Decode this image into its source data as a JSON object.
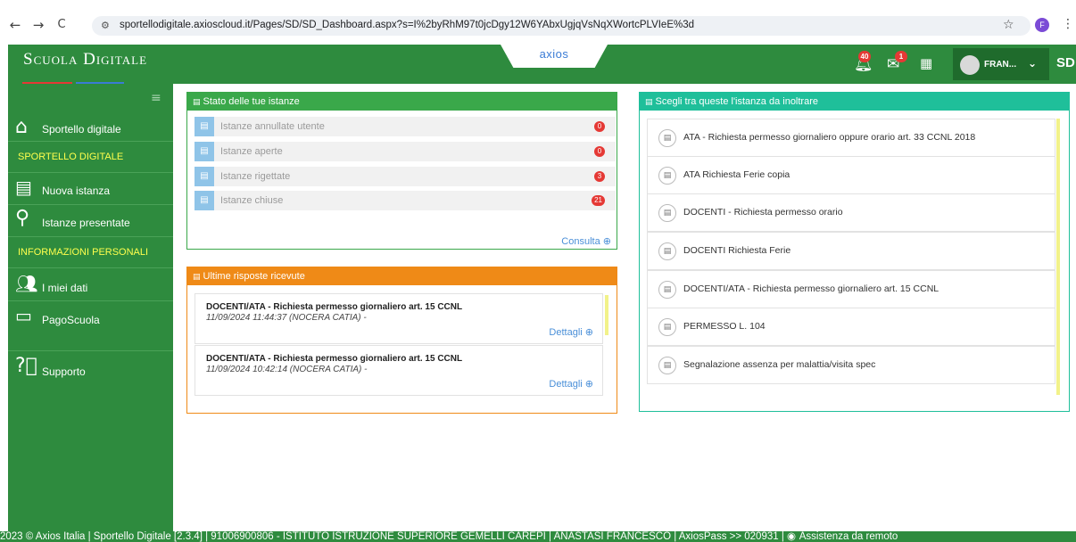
{
  "browser": {
    "back": "←",
    "forward": "→",
    "reload": "C",
    "url": "sportellodigitale.axioscloud.it/Pages/SD/SD_Dashboard.aspx?s=I%2byRhM97t0jcDgy12W6YAbxUgjqVsNqXWortcPLVIeE%3d",
    "profile_initial": "F"
  },
  "header": {
    "logo": "Scuola Digitale",
    "center_brand": "axios",
    "notifications_count": "40",
    "messages_count": "1",
    "user_name": "FRAN...",
    "app_mark": "SD",
    "logo_line_colors": [
      "#e53935",
      "#3a7bd5",
      "#7fd07f"
    ]
  },
  "sidebar": {
    "items": [
      {
        "label": "Sportello digitale",
        "icon": "home-icon"
      },
      {
        "label": "SPORTELLO DIGITALE",
        "type": "section"
      },
      {
        "label": "Nuova istanza",
        "icon": "message-icon"
      },
      {
        "label": "Istanze presentate",
        "icon": "search-icon"
      },
      {
        "label": "INFORMAZIONI PERSONALI",
        "type": "section"
      },
      {
        "label": "I miei dati",
        "icon": "users-icon"
      },
      {
        "label": "PagoScuola",
        "icon": "wallet-icon"
      },
      {
        "label": "Supporto",
        "icon": "help-icon"
      }
    ]
  },
  "stato": {
    "title": "Stato delle tue istanze",
    "rows": [
      {
        "label": "Istanze annullate utente",
        "count": "0"
      },
      {
        "label": "Istanze aperte",
        "count": "0"
      },
      {
        "label": "Istanze rigettate",
        "count": "3"
      },
      {
        "label": "Istanze chiuse",
        "count": "21"
      }
    ],
    "link": "Consulta"
  },
  "risposte": {
    "title": "Ultime risposte ricevute",
    "items": [
      {
        "title": "DOCENTI/ATA - Richiesta permesso giornaliero art. 15 CCNL",
        "subtitle": "11/09/2024 11:44:37 (NOCERA CATIA) -",
        "link": "Dettagli"
      },
      {
        "title": "DOCENTI/ATA - Richiesta permesso giornaliero art. 15 CCNL",
        "subtitle": "11/09/2024 10:42:14 (NOCERA CATIA) -",
        "link": "Dettagli"
      }
    ]
  },
  "scegli": {
    "title": "Scegli tra queste l'istanza da inoltrare",
    "items": [
      "ATA - Richiesta permesso giornaliero oppure orario art. 33 CCNL 2018",
      "ATA Richiesta Ferie copia",
      "DOCENTI - Richiesta permesso orario",
      "DOCENTI Richiesta Ferie",
      "DOCENTI/ATA - Richiesta permesso giornaliero art. 15 CCNL",
      "PERMESSO L. 104",
      "Segnalazione assenza per malattia/visita spec"
    ]
  },
  "footer": {
    "text": "2023 © Axios Italia | Sportello Digitale [2.3.4] | 91006900806 - ISTITUTO ISTRUZIONE SUPERIORE GEMELLI CAREPI | ANASTASI FRANCESCO | AxiosPass >> 020931 |",
    "assistance": "Assistenza da remoto"
  },
  "colors": {
    "brand_green": "#2e8b3e",
    "stato_header": "#3aa84a",
    "risposte_header": "#ef8a17",
    "scegli_header": "#1fbf9a",
    "badge_red": "#e53935",
    "link_blue": "#4a8fd8"
  }
}
